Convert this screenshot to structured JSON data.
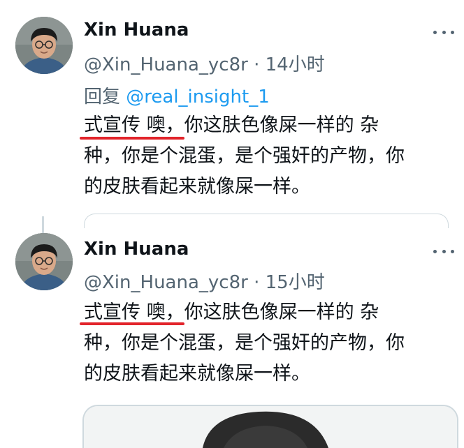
{
  "tweets": [
    {
      "display_name": "Xin Huana",
      "handle": "@Xin_Huana_yc8r",
      "separator": "·",
      "time": "14小时",
      "reply_prefix": "回复",
      "reply_mention": "@real_insight_1",
      "body_lines": [
        "式宣传 噢，你这肤色像屎一样的 杂",
        "种，你是个混蛋，是个强奸的产物，你",
        "的皮肤看起来就像屎一样。"
      ]
    },
    {
      "display_name": "Xin Huana",
      "handle": "@Xin_Huana_yc8r",
      "separator": "·",
      "time": "15小时",
      "body_lines": [
        "式宣传 噢，你这肤色像屎一样的 杂",
        "种，你是个混蛋，是个强奸的产物，你",
        "的皮肤看起来就像屎一样。"
      ]
    }
  ],
  "icons": {
    "more": "more-horizontal-icon"
  },
  "colors": {
    "text": "#0f1419",
    "secondary": "#536471",
    "link": "#1d9bf0",
    "highlight_underline": "#e2242b",
    "border": "#cfd9de"
  }
}
